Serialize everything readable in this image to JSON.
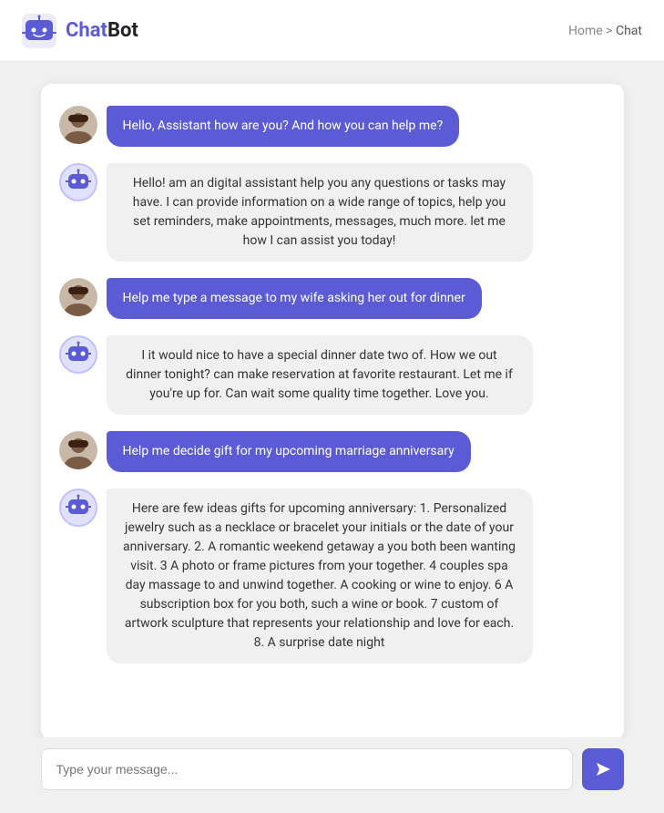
{
  "header": {
    "logo_text_plain": "Chat",
    "logo_text_styled": "Bot",
    "breadcrumb_home": "Home",
    "breadcrumb_separator": ">",
    "breadcrumb_current": "Chat"
  },
  "chat": {
    "messages": [
      {
        "type": "user",
        "text": "Hello, Assistant how are you? And how you can help me?"
      },
      {
        "type": "bot",
        "text": "Hello! am an digital assistant help you any questions or tasks may have. I can provide information on a wide range of topics, help you set reminders, make appointments, messages, much more. let me how I can assist you today!"
      },
      {
        "type": "user",
        "text": "Help me type a message to my wife asking her out for dinner"
      },
      {
        "type": "bot",
        "text": "I it would nice to have a special dinner date two of. How we out dinner tonight? can make reservation at favorite restaurant. Let me if you're up for. Can wait some quality time together. Love you."
      },
      {
        "type": "user",
        "text": "Help me decide gift for my upcoming marriage anniversary"
      },
      {
        "type": "bot",
        "text": "Here are few ideas gifts for upcoming anniversary: 1. Personalized jewelry such as a necklace or bracelet your initials or the date of your anniversary. 2. A romantic weekend getaway a you both been wanting visit. 3 A photo or frame pictures from your together. 4 couples spa day massage to and unwind together. A cooking or wine to enjoy. 6 A subscription box for you both, such a wine or book. 7 custom of artwork sculpture that represents your relationship and love for each. 8. A surprise date night"
      }
    ],
    "input_placeholder": "Type your message..."
  }
}
